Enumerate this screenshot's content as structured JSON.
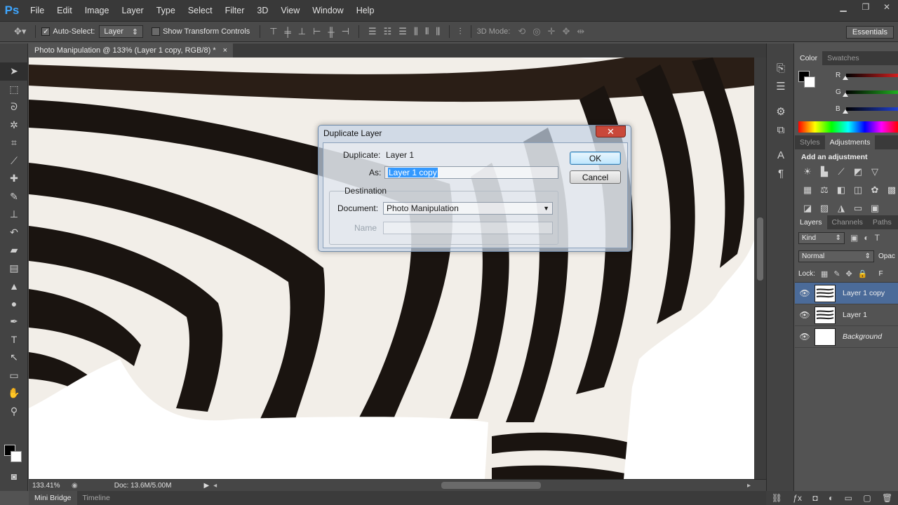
{
  "app": {
    "logo": "Ps"
  },
  "menu": [
    "File",
    "Edit",
    "Image",
    "Layer",
    "Type",
    "Select",
    "Filter",
    "3D",
    "View",
    "Window",
    "Help"
  ],
  "options_bar": {
    "auto_select_label": "Auto-Select:",
    "auto_select_value": "Layer",
    "show_transform_label": "Show Transform Controls",
    "mode_3d_label": "3D Mode:",
    "workspace": "Essentials"
  },
  "document": {
    "tab_title": "Photo Manipulation @ 133% (Layer 1 copy, RGB/8) *",
    "close_glyph": "×"
  },
  "status": {
    "zoom": "133.41%",
    "doc_size": "Doc: 13.6M/5.00M"
  },
  "bottom_tabs": [
    "Mini Bridge",
    "Timeline"
  ],
  "color_panel": {
    "tabs": [
      "Color",
      "Swatches"
    ],
    "sliders": [
      {
        "label": "R",
        "track": "#d02020"
      },
      {
        "label": "G",
        "track": "#20b020"
      },
      {
        "label": "B",
        "track": "#2040d0"
      }
    ]
  },
  "adjustments_panel": {
    "tabs": [
      "Styles",
      "Adjustments"
    ],
    "heading": "Add an adjustment"
  },
  "layers_panel": {
    "tabs": [
      "Layers",
      "Channels",
      "Paths"
    ],
    "filter_kind": "Kind",
    "blend_mode": "Normal",
    "opacity_label": "Opac",
    "lock_label": "Lock:",
    "fill_label": "F",
    "layers": [
      {
        "name": "Layer 1 copy",
        "selected": true,
        "italic": false
      },
      {
        "name": "Layer 1",
        "selected": false,
        "italic": false
      },
      {
        "name": "Background",
        "selected": false,
        "italic": true
      }
    ]
  },
  "dialog": {
    "title": "Duplicate Layer",
    "close_glyph": "✕",
    "duplicate_label": "Duplicate:",
    "duplicate_value": "Layer 1",
    "as_label": "As:",
    "as_value": "Layer 1 copy",
    "destination_label": "Destination",
    "document_label": "Document:",
    "document_value": "Photo Manipulation",
    "name_label": "Name",
    "ok_label": "OK",
    "cancel_label": "Cancel"
  }
}
